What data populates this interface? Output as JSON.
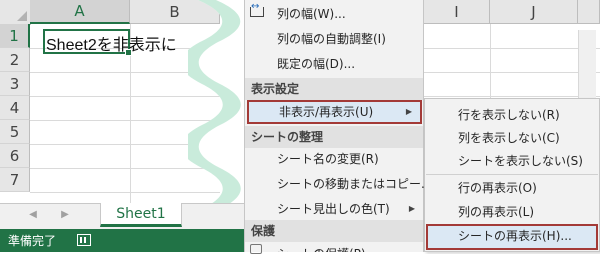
{
  "grid": {
    "columns": [
      "A",
      "B",
      "I",
      "J"
    ],
    "rows": [
      "1",
      "2",
      "3",
      "4",
      "5",
      "6",
      "7"
    ],
    "active_cell_value": "Sheet2を非表示に"
  },
  "sheet_tabs": [
    "Sheet1"
  ],
  "status_bar": {
    "ready_label": "準備完了"
  },
  "context_menu": {
    "items": [
      {
        "label": "列の幅(W)...",
        "type": "item",
        "icon": "column-width-icon"
      },
      {
        "label": "列の幅の自動調整(I)",
        "type": "item"
      },
      {
        "label": "既定の幅(D)...",
        "type": "item"
      },
      {
        "label": "表示設定",
        "type": "section"
      },
      {
        "label": "非表示/再表示(U)",
        "type": "submenu",
        "highlighted": true
      },
      {
        "label": "シートの整理",
        "type": "section"
      },
      {
        "label": "シート名の変更(R)",
        "type": "item"
      },
      {
        "label": "シートの移動またはコピー...",
        "type": "item"
      },
      {
        "label": "シート見出しの色(T)",
        "type": "submenu"
      },
      {
        "label": "保護",
        "type": "section"
      },
      {
        "label": "シートの保護(P)...",
        "type": "item",
        "icon": "protect-sheet-icon"
      }
    ]
  },
  "submenu": {
    "items": [
      {
        "label": "行を表示しない(R)"
      },
      {
        "label": "列を表示しない(C)"
      },
      {
        "label": "シートを表示しない(S)"
      },
      {
        "label": "行の再表示(O)"
      },
      {
        "label": "列の再表示(L)"
      },
      {
        "label": "シートの再表示(H)...",
        "highlighted": true
      }
    ]
  },
  "colors": {
    "excel_green": "#217346",
    "highlight_border": "#a33a37",
    "highlight_fill": "#dbe8f4",
    "wave_fill": "#c9ebdb"
  }
}
